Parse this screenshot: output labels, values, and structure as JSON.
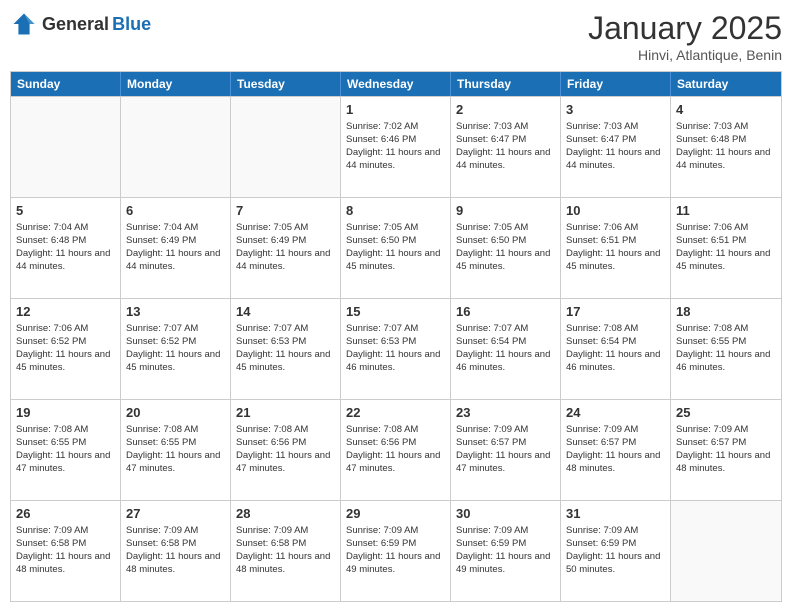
{
  "header": {
    "logo": {
      "general": "General",
      "blue": "Blue"
    },
    "title": "January 2025",
    "location": "Hinvi, Atlantique, Benin"
  },
  "weekdays": [
    "Sunday",
    "Monday",
    "Tuesday",
    "Wednesday",
    "Thursday",
    "Friday",
    "Saturday"
  ],
  "rows": [
    [
      {
        "day": "",
        "text": ""
      },
      {
        "day": "",
        "text": ""
      },
      {
        "day": "",
        "text": ""
      },
      {
        "day": "1",
        "text": "Sunrise: 7:02 AM\nSunset: 6:46 PM\nDaylight: 11 hours and 44 minutes."
      },
      {
        "day": "2",
        "text": "Sunrise: 7:03 AM\nSunset: 6:47 PM\nDaylight: 11 hours and 44 minutes."
      },
      {
        "day": "3",
        "text": "Sunrise: 7:03 AM\nSunset: 6:47 PM\nDaylight: 11 hours and 44 minutes."
      },
      {
        "day": "4",
        "text": "Sunrise: 7:03 AM\nSunset: 6:48 PM\nDaylight: 11 hours and 44 minutes."
      }
    ],
    [
      {
        "day": "5",
        "text": "Sunrise: 7:04 AM\nSunset: 6:48 PM\nDaylight: 11 hours and 44 minutes."
      },
      {
        "day": "6",
        "text": "Sunrise: 7:04 AM\nSunset: 6:49 PM\nDaylight: 11 hours and 44 minutes."
      },
      {
        "day": "7",
        "text": "Sunrise: 7:05 AM\nSunset: 6:49 PM\nDaylight: 11 hours and 44 minutes."
      },
      {
        "day": "8",
        "text": "Sunrise: 7:05 AM\nSunset: 6:50 PM\nDaylight: 11 hours and 45 minutes."
      },
      {
        "day": "9",
        "text": "Sunrise: 7:05 AM\nSunset: 6:50 PM\nDaylight: 11 hours and 45 minutes."
      },
      {
        "day": "10",
        "text": "Sunrise: 7:06 AM\nSunset: 6:51 PM\nDaylight: 11 hours and 45 minutes."
      },
      {
        "day": "11",
        "text": "Sunrise: 7:06 AM\nSunset: 6:51 PM\nDaylight: 11 hours and 45 minutes."
      }
    ],
    [
      {
        "day": "12",
        "text": "Sunrise: 7:06 AM\nSunset: 6:52 PM\nDaylight: 11 hours and 45 minutes."
      },
      {
        "day": "13",
        "text": "Sunrise: 7:07 AM\nSunset: 6:52 PM\nDaylight: 11 hours and 45 minutes."
      },
      {
        "day": "14",
        "text": "Sunrise: 7:07 AM\nSunset: 6:53 PM\nDaylight: 11 hours and 45 minutes."
      },
      {
        "day": "15",
        "text": "Sunrise: 7:07 AM\nSunset: 6:53 PM\nDaylight: 11 hours and 46 minutes."
      },
      {
        "day": "16",
        "text": "Sunrise: 7:07 AM\nSunset: 6:54 PM\nDaylight: 11 hours and 46 minutes."
      },
      {
        "day": "17",
        "text": "Sunrise: 7:08 AM\nSunset: 6:54 PM\nDaylight: 11 hours and 46 minutes."
      },
      {
        "day": "18",
        "text": "Sunrise: 7:08 AM\nSunset: 6:55 PM\nDaylight: 11 hours and 46 minutes."
      }
    ],
    [
      {
        "day": "19",
        "text": "Sunrise: 7:08 AM\nSunset: 6:55 PM\nDaylight: 11 hours and 47 minutes."
      },
      {
        "day": "20",
        "text": "Sunrise: 7:08 AM\nSunset: 6:55 PM\nDaylight: 11 hours and 47 minutes."
      },
      {
        "day": "21",
        "text": "Sunrise: 7:08 AM\nSunset: 6:56 PM\nDaylight: 11 hours and 47 minutes."
      },
      {
        "day": "22",
        "text": "Sunrise: 7:08 AM\nSunset: 6:56 PM\nDaylight: 11 hours and 47 minutes."
      },
      {
        "day": "23",
        "text": "Sunrise: 7:09 AM\nSunset: 6:57 PM\nDaylight: 11 hours and 47 minutes."
      },
      {
        "day": "24",
        "text": "Sunrise: 7:09 AM\nSunset: 6:57 PM\nDaylight: 11 hours and 48 minutes."
      },
      {
        "day": "25",
        "text": "Sunrise: 7:09 AM\nSunset: 6:57 PM\nDaylight: 11 hours and 48 minutes."
      }
    ],
    [
      {
        "day": "26",
        "text": "Sunrise: 7:09 AM\nSunset: 6:58 PM\nDaylight: 11 hours and 48 minutes."
      },
      {
        "day": "27",
        "text": "Sunrise: 7:09 AM\nSunset: 6:58 PM\nDaylight: 11 hours and 48 minutes."
      },
      {
        "day": "28",
        "text": "Sunrise: 7:09 AM\nSunset: 6:58 PM\nDaylight: 11 hours and 48 minutes."
      },
      {
        "day": "29",
        "text": "Sunrise: 7:09 AM\nSunset: 6:59 PM\nDaylight: 11 hours and 49 minutes."
      },
      {
        "day": "30",
        "text": "Sunrise: 7:09 AM\nSunset: 6:59 PM\nDaylight: 11 hours and 49 minutes."
      },
      {
        "day": "31",
        "text": "Sunrise: 7:09 AM\nSunset: 6:59 PM\nDaylight: 11 hours and 50 minutes."
      },
      {
        "day": "",
        "text": ""
      }
    ]
  ]
}
